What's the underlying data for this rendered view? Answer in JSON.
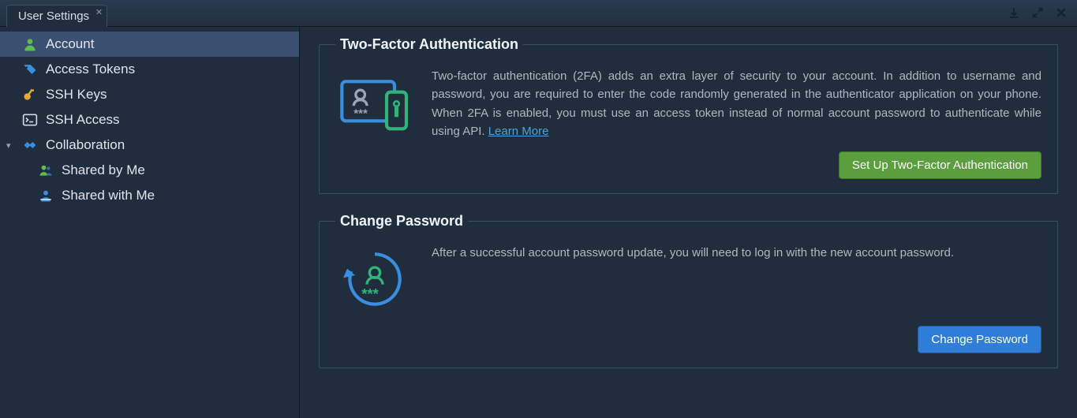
{
  "tab": {
    "title": "User Settings"
  },
  "sidebar": {
    "items": [
      {
        "label": "Account"
      },
      {
        "label": "Access Tokens"
      },
      {
        "label": "SSH Keys"
      },
      {
        "label": "SSH Access"
      },
      {
        "label": "Collaboration"
      },
      {
        "label": "Shared by Me"
      },
      {
        "label": "Shared with Me"
      }
    ]
  },
  "panels": {
    "tfa": {
      "title": "Two-Factor Authentication",
      "body": "Two-factor authentication (2FA) adds an extra layer of security to your account. In addition to username and password, you are required to enter the code randomly generated in the authenticator application on your phone. When 2FA is enabled, you must use an access token instead of normal account password to authenticate while using API. ",
      "learn_more": "Learn More",
      "button": "Set Up Two-Factor Authentication"
    },
    "pwd": {
      "title": "Change Password",
      "body": "After a successful account password update, you will need to log in with the new account password.",
      "button": "Change Password"
    }
  }
}
